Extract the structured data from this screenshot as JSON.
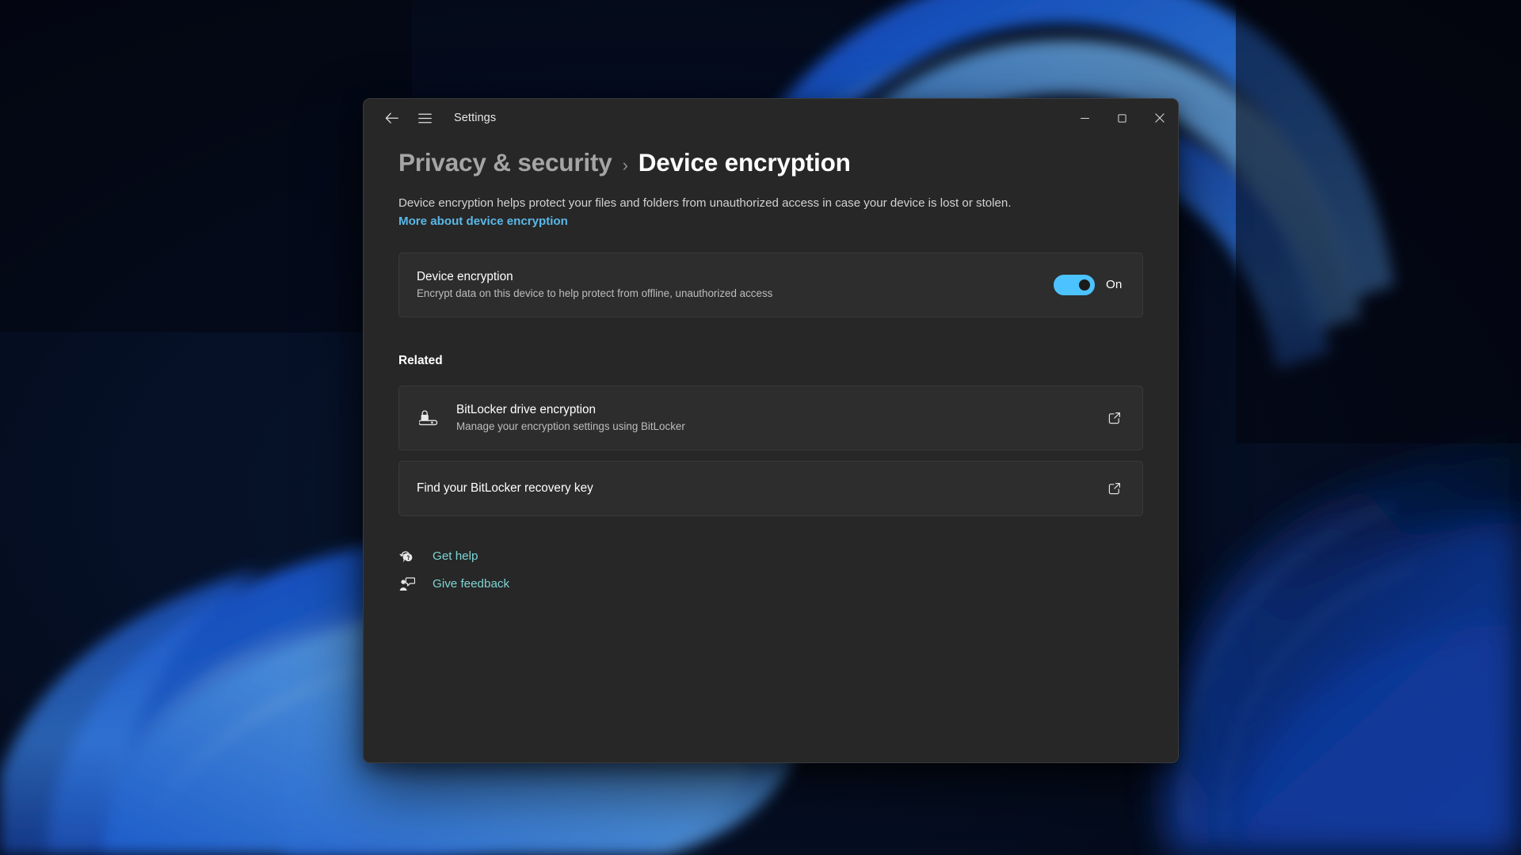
{
  "window": {
    "title": "Settings",
    "back_icon": "back-arrow-icon",
    "nav_icon": "hamburger-menu-icon",
    "minimize_label": "Minimize",
    "maximize_label": "Maximize",
    "close_label": "Close"
  },
  "breadcrumb": {
    "parent": "Privacy & security",
    "separator": "›",
    "current": "Device encryption"
  },
  "description": {
    "text": "Device encryption helps protect your files and folders from unauthorized access in case your device is lost or stolen. ",
    "link": "More about device encryption"
  },
  "encryption_setting": {
    "title": "Device encryption",
    "subtitle": "Encrypt data on this device to help protect from offline, unauthorized access",
    "toggle_state": "On",
    "toggle_on": true
  },
  "related": {
    "heading": "Related",
    "items": [
      {
        "title": "BitLocker drive encryption",
        "subtitle": "Manage your encryption settings using BitLocker",
        "icon": "bitlocker-drive-icon",
        "action_icon": "open-external-icon"
      },
      {
        "title": "Find your BitLocker recovery key",
        "subtitle": "",
        "icon": "",
        "action_icon": "open-external-icon"
      }
    ]
  },
  "footer": {
    "links": [
      {
        "label": "Get help",
        "icon": "help-question-icon"
      },
      {
        "label": "Give feedback",
        "icon": "feedback-person-icon"
      }
    ]
  },
  "colors": {
    "accent": "#4cc2ff",
    "link": "#5bb8e8",
    "footer_link": "#7fd4d4",
    "window_bg": "#272727",
    "card_bg": "#2d2d2d"
  }
}
